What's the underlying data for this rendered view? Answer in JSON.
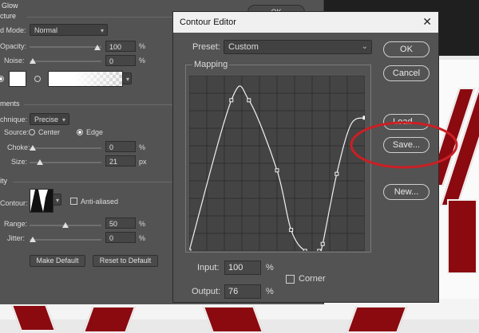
{
  "layer_style": {
    "section_title": "Glow",
    "structure_header": "cture",
    "blend_mode": {
      "label": "d Mode:",
      "value": "Normal"
    },
    "opacity": {
      "label": "Opacity:",
      "value": "100",
      "unit": "%"
    },
    "noise": {
      "label": "Noise:",
      "value": "0",
      "unit": "%"
    },
    "elements_header": "ments",
    "technique": {
      "label": "chnique:",
      "value": "Precise"
    },
    "source": {
      "label": "Source:",
      "options": [
        "Center",
        "Edge"
      ],
      "selected": "Edge"
    },
    "choke": {
      "label": "Choke:",
      "value": "0",
      "unit": "%"
    },
    "size": {
      "label": "Size:",
      "value": "21",
      "unit": "px"
    },
    "quality_header": "ity",
    "contour": {
      "label": "Contour:",
      "anti_aliased_label": "Anti-aliased"
    },
    "range": {
      "label": "Range:",
      "value": "50",
      "unit": "%"
    },
    "jitter": {
      "label": "Jitter:",
      "value": "0",
      "unit": "%"
    },
    "make_default_label": "Make Default",
    "reset_default_label": "Reset to Default",
    "ok_label": "OK"
  },
  "contour_editor": {
    "title": "Contour Editor",
    "close_glyph": "✕",
    "preset_label": "Preset:",
    "preset_value": "Custom",
    "mapping_label": "Mapping",
    "input_label": "Input:",
    "input_value": "100",
    "input_unit": "%",
    "output_label": "Output:",
    "output_value": "76",
    "output_unit": "%",
    "corner_label": "Corner",
    "buttons": {
      "ok": "OK",
      "cancel": "Cancel",
      "load": "Load...",
      "save": "Save...",
      "new": "New..."
    },
    "highlight_color": "#cc1f24",
    "curve_points": [
      [
        0,
        0
      ],
      [
        24,
        86
      ],
      [
        34,
        86
      ],
      [
        50,
        46
      ],
      [
        58,
        12
      ],
      [
        66,
        0
      ],
      [
        74,
        0
      ],
      [
        76,
        4
      ],
      [
        84,
        44
      ],
      [
        92,
        72
      ],
      [
        100,
        76
      ]
    ],
    "curve_anchor_points": [
      [
        0,
        0
      ],
      [
        24,
        86
      ],
      [
        34,
        86
      ],
      [
        50,
        46
      ],
      [
        58,
        12
      ],
      [
        66,
        0
      ],
      [
        74,
        0
      ],
      [
        76,
        4
      ],
      [
        84,
        44
      ],
      [
        100,
        76
      ]
    ]
  }
}
